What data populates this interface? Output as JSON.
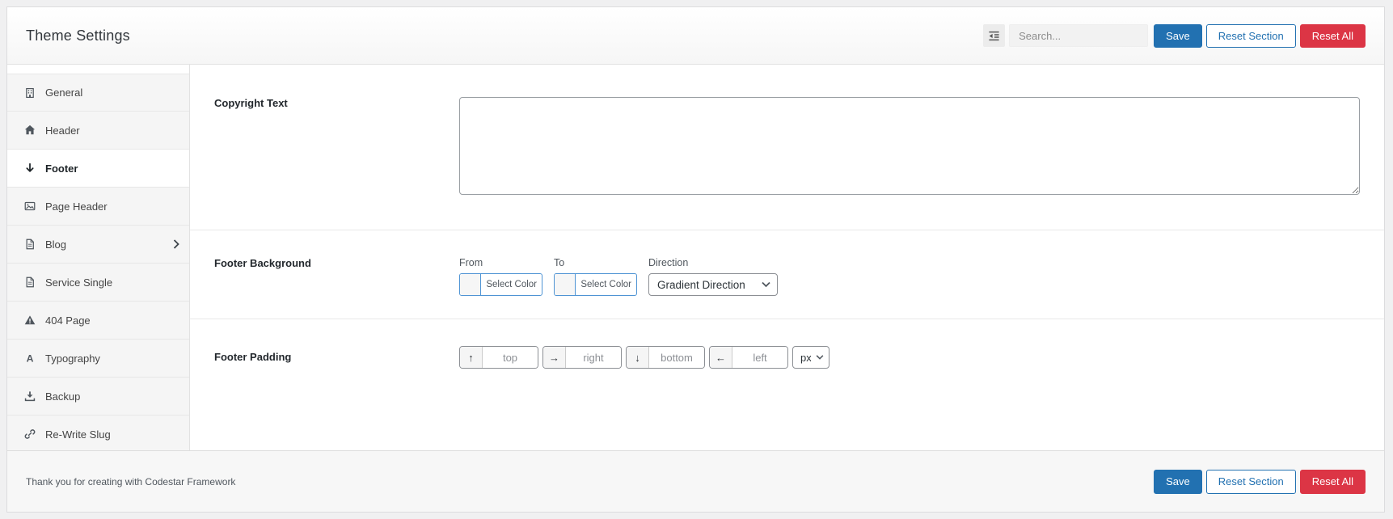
{
  "header": {
    "title": "Theme Settings",
    "search": {
      "placeholder": "Search..."
    },
    "buttons": {
      "save": "Save",
      "reset_section": "Reset Section",
      "reset_all": "Reset All"
    }
  },
  "sidebar": {
    "items": [
      {
        "label": "General",
        "icon": "building-icon",
        "active": false,
        "has_children": false
      },
      {
        "label": "Header",
        "icon": "home-icon",
        "active": false,
        "has_children": false
      },
      {
        "label": "Footer",
        "icon": "arrow-down-icon",
        "active": true,
        "has_children": false
      },
      {
        "label": "Page Header",
        "icon": "image-icon",
        "active": false,
        "has_children": false
      },
      {
        "label": "Blog",
        "icon": "file-icon",
        "active": false,
        "has_children": true
      },
      {
        "label": "Service Single",
        "icon": "file-icon",
        "active": false,
        "has_children": false
      },
      {
        "label": "404 Page",
        "icon": "warning-icon",
        "active": false,
        "has_children": false
      },
      {
        "label": "Typography",
        "icon": "font-icon",
        "active": false,
        "has_children": false
      },
      {
        "label": "Backup",
        "icon": "download-icon",
        "active": false,
        "has_children": false
      },
      {
        "label": "Re-Write Slug",
        "icon": "link-icon",
        "active": false,
        "has_children": false
      }
    ]
  },
  "content": {
    "copyright": {
      "label": "Copyright Text",
      "value": ""
    },
    "background": {
      "label": "Footer Background",
      "from_label": "From",
      "to_label": "To",
      "direction_label": "Direction",
      "select_color_label": "Select Color",
      "direction_value": "Gradient Direction"
    },
    "padding": {
      "label": "Footer Padding",
      "fields": [
        {
          "icon": "↑",
          "placeholder": "top"
        },
        {
          "icon": "→",
          "placeholder": "right"
        },
        {
          "icon": "↓",
          "placeholder": "bottom"
        },
        {
          "icon": "←",
          "placeholder": "left"
        }
      ],
      "unit": "px"
    }
  },
  "footer": {
    "text": "Thank you for creating with Codestar Framework",
    "buttons": {
      "save": "Save",
      "reset_section": "Reset Section",
      "reset_all": "Reset All"
    }
  },
  "colors": {
    "primary": "#2271b1",
    "danger": "#dc3545",
    "picker_border": "#4f94d4"
  }
}
